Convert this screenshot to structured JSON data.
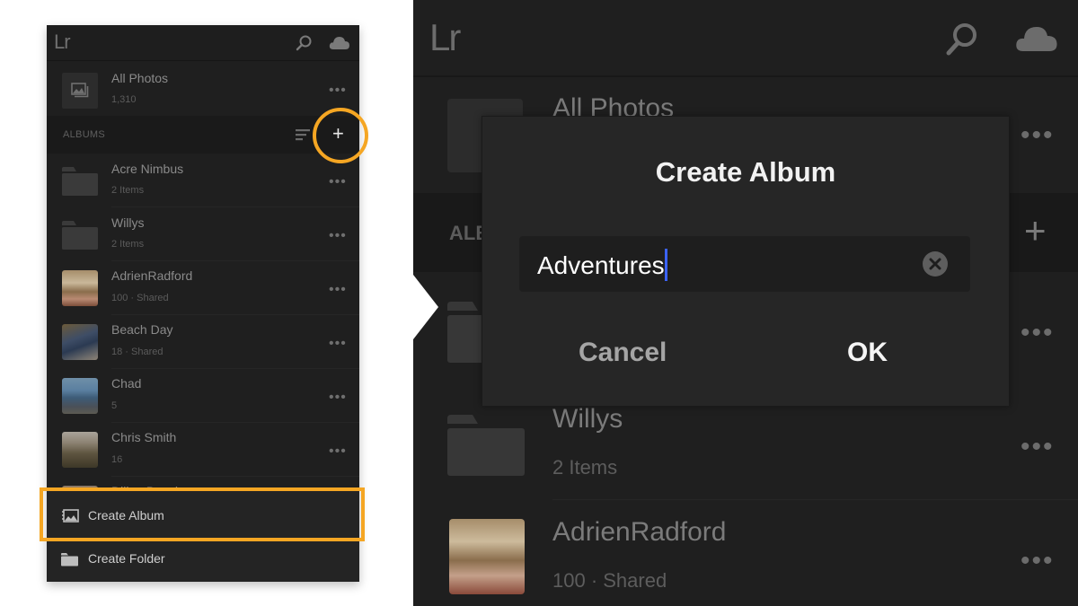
{
  "app": {
    "logo": "Lr"
  },
  "left_panel": {
    "all_photos": {
      "title": "All Photos",
      "count": "1,310",
      "more": "•••"
    },
    "albums_header": {
      "label": "ALBUMS",
      "add": "+"
    },
    "albums": [
      {
        "name": "Acre Nimbus",
        "meta": "2 Items",
        "type": "folder",
        "more": "•••"
      },
      {
        "name": "Willys",
        "meta": "2 Items",
        "type": "folder",
        "more": "•••"
      },
      {
        "name": "AdrienRadford",
        "meta": "100 · Shared",
        "type": "photo",
        "more": "•••"
      },
      {
        "name": "Beach Day",
        "meta": "18 · Shared",
        "type": "photo",
        "more": "•••"
      },
      {
        "name": "Chad",
        "meta": "5",
        "type": "photo",
        "more": "•••"
      },
      {
        "name": "Chris Smith",
        "meta": "16",
        "type": "photo",
        "more": "•••"
      },
      {
        "name": "Dillon Beach",
        "meta": "",
        "type": "photo",
        "more": ""
      }
    ],
    "menu": [
      {
        "label": "Create Album",
        "icon": "album-icon"
      },
      {
        "label": "Create Folder",
        "icon": "folder-icon"
      }
    ]
  },
  "right_panel": {
    "all_photos_title": "All Photos",
    "albums_label": "ALBUMS",
    "add": "+",
    "rows": [
      {
        "name": "Willys",
        "meta": "2 Items",
        "more": "•••"
      },
      {
        "name": "AdrienRadford",
        "meta": "100 · Shared",
        "more": "•••"
      }
    ],
    "more": "•••"
  },
  "dialog": {
    "title": "Create Album",
    "input_value": "Adventures",
    "cancel_label": "Cancel",
    "ok_label": "OK"
  },
  "colors": {
    "highlight": "#f5a623",
    "caret": "#3b63ff",
    "background": "#1f1f1f"
  }
}
